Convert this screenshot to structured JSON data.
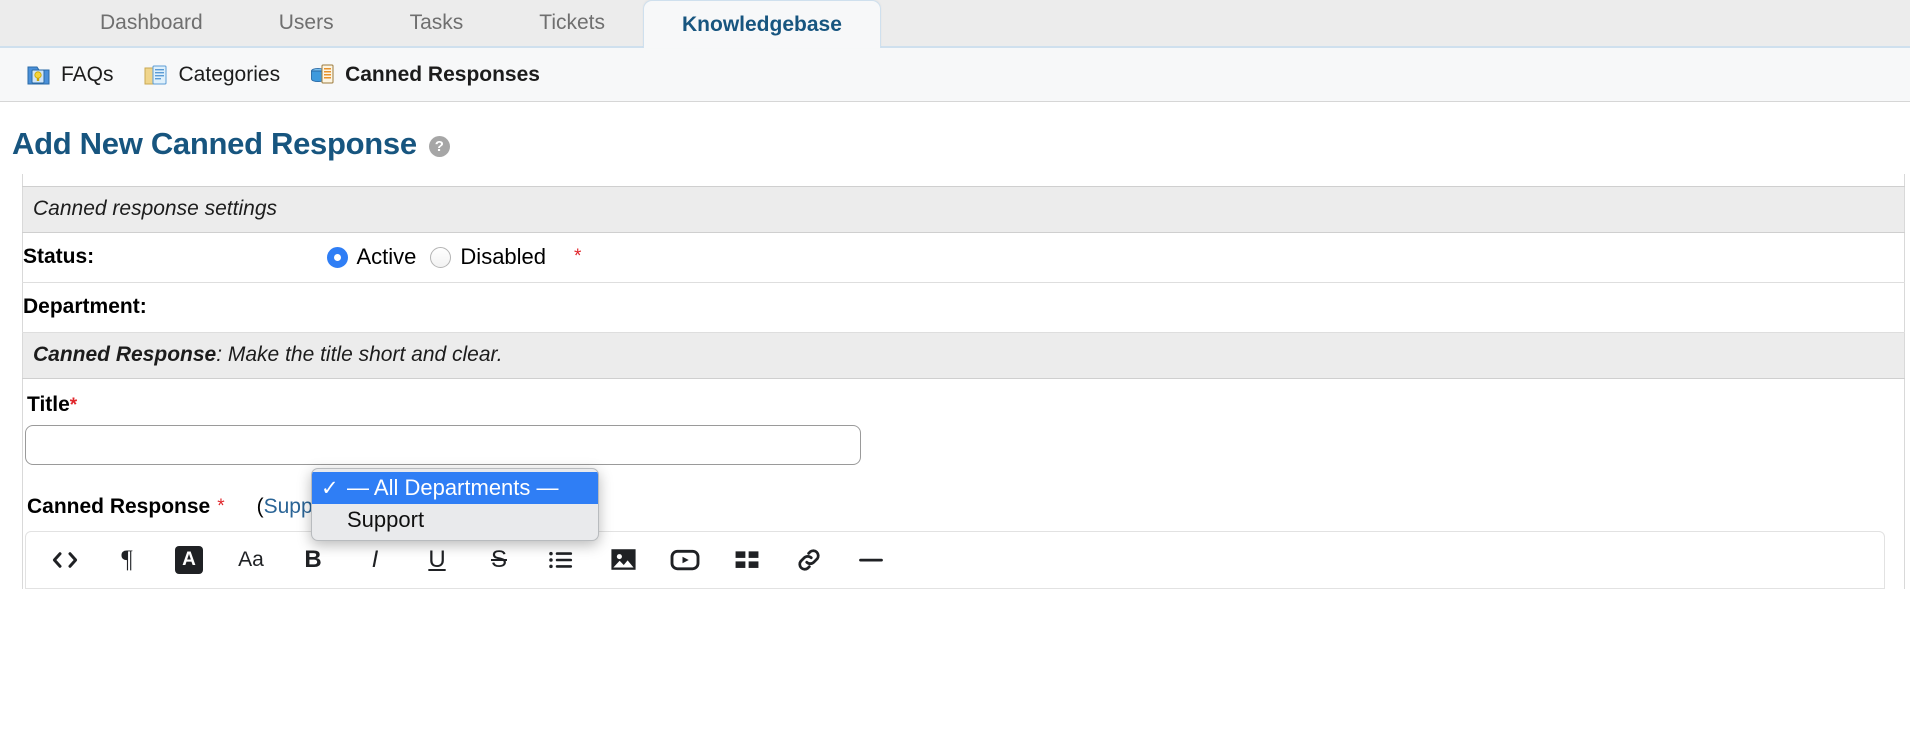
{
  "tabs": [
    {
      "label": "Dashboard",
      "active": false
    },
    {
      "label": "Users",
      "active": false
    },
    {
      "label": "Tasks",
      "active": false
    },
    {
      "label": "Tickets",
      "active": false
    },
    {
      "label": "Knowledgebase",
      "active": true
    }
  ],
  "subnav": [
    {
      "label": "FAQs",
      "icon": "faq-folder-icon",
      "current": false
    },
    {
      "label": "Categories",
      "icon": "categories-folder-icon",
      "current": false
    },
    {
      "label": "Canned Responses",
      "icon": "canned-responses-icon",
      "current": true
    }
  ],
  "page": {
    "title": "Add New Canned Response",
    "help_icon": "?"
  },
  "form": {
    "settings_section": "Canned response settings",
    "status": {
      "label": "Status:",
      "options": [
        {
          "label": "Active",
          "selected": true
        },
        {
          "label": "Disabled",
          "selected": false
        }
      ],
      "required_mark": "*"
    },
    "department": {
      "label": "Department:",
      "selected_value": "— All Departments —",
      "dropdown_open": true,
      "options": [
        {
          "label": "— All Departments —",
          "selected": true,
          "check": "✓"
        },
        {
          "label": "Support",
          "selected": false,
          "check": ""
        }
      ]
    },
    "response_section": {
      "bold_part": "Canned Response",
      "rest": ": Make the title short and clear."
    },
    "title_field": {
      "label": "Title",
      "required_mark": "*",
      "value": "",
      "placeholder": ""
    },
    "body_field": {
      "label": "Canned Response",
      "required_mark": "*",
      "link_open": "(",
      "link_text": "Supported Variables",
      "link_close": ")"
    }
  },
  "editor_toolbar": [
    {
      "name": "source-code-icon",
      "kind": "svg",
      "glyph": "code"
    },
    {
      "name": "paragraph-icon",
      "kind": "text",
      "glyph": "¶",
      "style": "para"
    },
    {
      "name": "text-color-icon",
      "kind": "swatch",
      "glyph": "A"
    },
    {
      "name": "font-size-icon",
      "kind": "text",
      "glyph": "Aa",
      "style": "aa"
    },
    {
      "name": "bold-icon",
      "kind": "text",
      "glyph": "B",
      "style": "bold"
    },
    {
      "name": "italic-icon",
      "kind": "text",
      "glyph": "I",
      "style": "ital"
    },
    {
      "name": "underline-icon",
      "kind": "text",
      "glyph": "U",
      "style": "undl"
    },
    {
      "name": "strikethrough-icon",
      "kind": "text",
      "glyph": "S",
      "style": "strk"
    },
    {
      "name": "bullet-list-icon",
      "kind": "svg",
      "glyph": "list"
    },
    {
      "name": "insert-image-icon",
      "kind": "svg",
      "glyph": "image"
    },
    {
      "name": "insert-video-icon",
      "kind": "svg",
      "glyph": "video"
    },
    {
      "name": "insert-table-icon",
      "kind": "svg",
      "glyph": "table"
    },
    {
      "name": "insert-link-icon",
      "kind": "svg",
      "glyph": "link"
    },
    {
      "name": "horizontal-rule-icon",
      "kind": "svg",
      "glyph": "hr"
    }
  ],
  "colors": {
    "accent_blue": "#17557f",
    "selection_blue": "#2f7ef5",
    "link_blue": "#2a6496",
    "required_red": "#e0262b",
    "section_grey": "#ececec"
  }
}
